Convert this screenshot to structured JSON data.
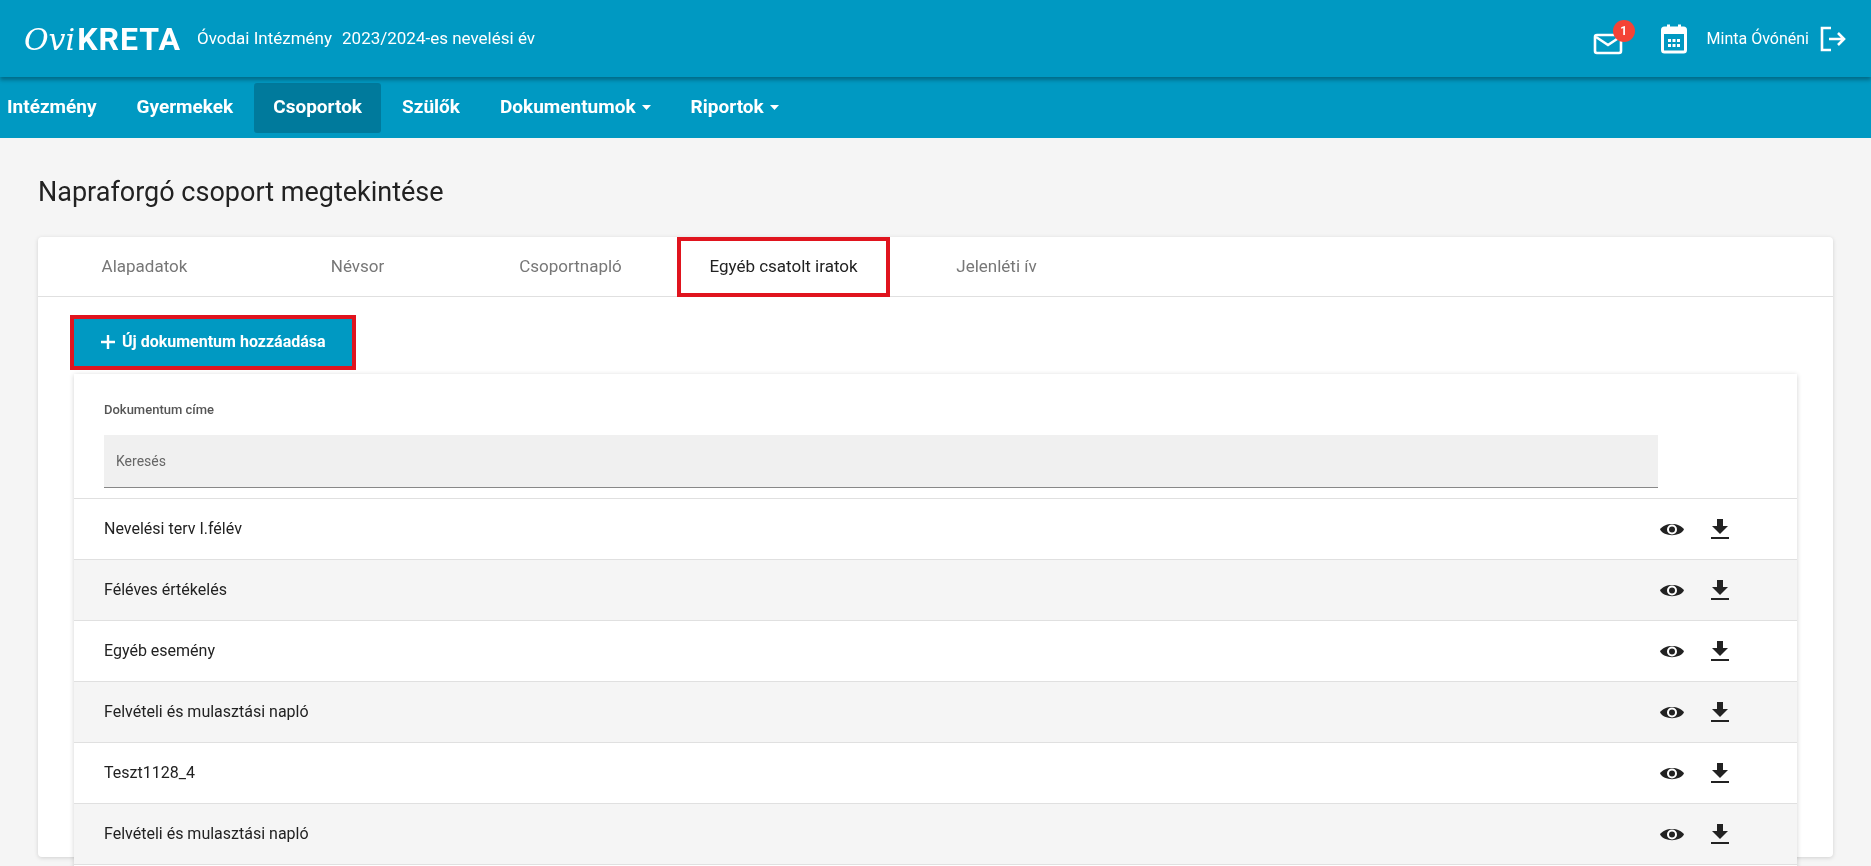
{
  "header": {
    "logo": {
      "script": "Ovi",
      "wordmark": "KRETA"
    },
    "institution": "Óvodai Intézmény",
    "school_year": "2023/2024-es nevelési év",
    "mail_badge": "1",
    "user": "Minta Óvónéni"
  },
  "nav": [
    {
      "label": "Intézmény",
      "selected": false,
      "dropdown": false
    },
    {
      "label": "Gyermekek",
      "selected": false,
      "dropdown": false
    },
    {
      "label": "Csoportok",
      "selected": true,
      "dropdown": false
    },
    {
      "label": "Szülők",
      "selected": false,
      "dropdown": false
    },
    {
      "label": "Dokumentumok",
      "selected": false,
      "dropdown": true
    },
    {
      "label": "Riportok",
      "selected": false,
      "dropdown": true
    }
  ],
  "page_title": "Napraforgó csoport megtekintése",
  "tabs": [
    {
      "label": "Alapadatok",
      "selected": false,
      "highlighted": false
    },
    {
      "label": "Névsor",
      "selected": false,
      "highlighted": false
    },
    {
      "label": "Csoportnapló",
      "selected": false,
      "highlighted": false
    },
    {
      "label": "Egyéb csatolt iratok",
      "selected": true,
      "highlighted": true
    },
    {
      "label": "Jelenléti ív",
      "selected": false,
      "highlighted": false
    }
  ],
  "add_button": {
    "label": "Új dokumentum hozzáadása",
    "highlighted": true
  },
  "table": {
    "column": "Dokumentum címe",
    "search": {
      "placeholder": "Keresés"
    },
    "rows": [
      {
        "title": "Nevelési terv I.félév"
      },
      {
        "title": "Féléves értékelés"
      },
      {
        "title": "Egyéb esemény"
      },
      {
        "title": "Felvételi és mulasztási napló"
      },
      {
        "title": "Teszt1128_4"
      },
      {
        "title": "Felvételi és mulasztási napló"
      }
    ]
  }
}
